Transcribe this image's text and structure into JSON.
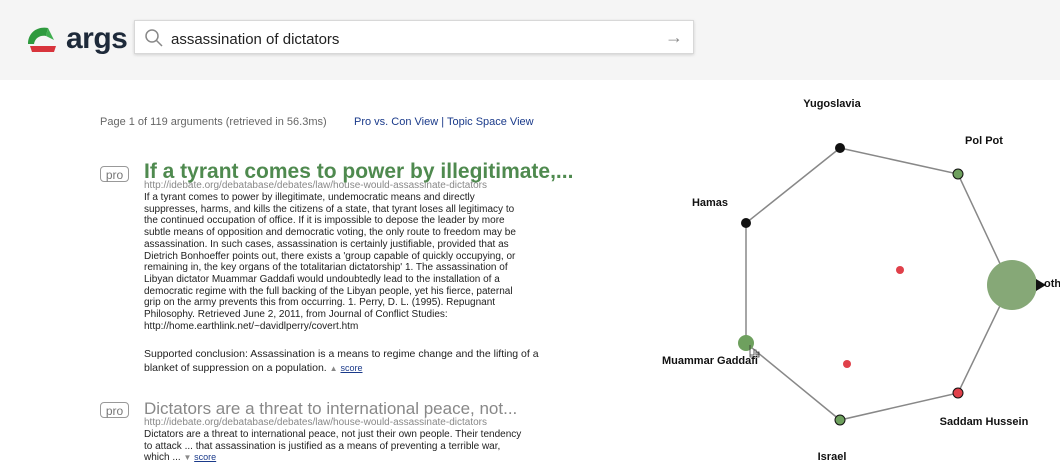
{
  "app": {
    "logo_text": "args"
  },
  "search": {
    "query": "assassination of dictators",
    "arrow": "→"
  },
  "results": {
    "page_info": "Page 1 of 119 arguments (retrieved in 56.3ms)",
    "view_pro_con": "Pro vs. Con View",
    "separator": "|",
    "view_topic_space": "Topic Space View"
  },
  "arguments": [
    {
      "stance": "pro",
      "title": "If a tyrant comes to power by illegitimate,...",
      "url": "http://idebate.org/debatabase/debates/law/house-would-assassinate-dictators",
      "body_lines": [
        "If a tyrant comes to power by illegitimate, undemocratic means and directly",
        "suppresses, harms, and kills the citizens of a state, that tyrant loses all legitimacy to",
        "the continued occupation of office. If it is impossible to depose the leader by more",
        "subtle means of opposition and democratic voting, the only route to freedom may be",
        "assassination. In such cases, assassination is certainly justifiable, provided that as",
        "Dietrich Bonhoeffer points out, there exists a 'group capable of quickly occupying, or",
        "remaining in, the key organs of the totalitarian dictatorship' 1. The assassination of",
        "Libyan dictator Muammar Gaddafi would undoubtedly lead to the installation of a",
        "democratic regime with the full backing of the Libyan people, yet his fierce, paternal",
        "grip on the army prevents this from occurring. 1. Perry, D. L. (1995). Repugnant",
        "Philosophy. Retrieved June 2, 2011, from Journal of Conflict Studies:",
        "http://home.earthlink.net/~davidlperry/covert.htm"
      ],
      "conclusion_line1": "Supported conclusion: Assassination is a means to regime change and the lifting of a",
      "conclusion_line2": "blanket of suppression on a population.",
      "score_label": "score"
    },
    {
      "stance": "pro",
      "title": "Dictators are a threat to international peace, not...",
      "url": "http://idebate.org/debatabase/debates/law/house-would-assassinate-dictators",
      "body_line1": "Dictators are a threat to international peace, not just their own people. Their tendency",
      "body_line2": "to attack ... that assassination is justified as a means of preventing a terrible war,",
      "body_line3": "which ...",
      "score_label": "score"
    }
  ],
  "topic_graph": {
    "nodes": [
      {
        "label": "Yugoslavia"
      },
      {
        "label": "Pol Pot"
      },
      {
        "label": "othe"
      },
      {
        "label": "Saddam Hussein"
      },
      {
        "label": "Israel"
      },
      {
        "label": "Muammar Gaddafi"
      },
      {
        "label": "Hamas"
      }
    ],
    "colors": {
      "edge": "#888888",
      "big_node": "#86a877",
      "green_node": "#6ea05e",
      "red_node": "#e0404a",
      "black_node": "#111111"
    }
  }
}
